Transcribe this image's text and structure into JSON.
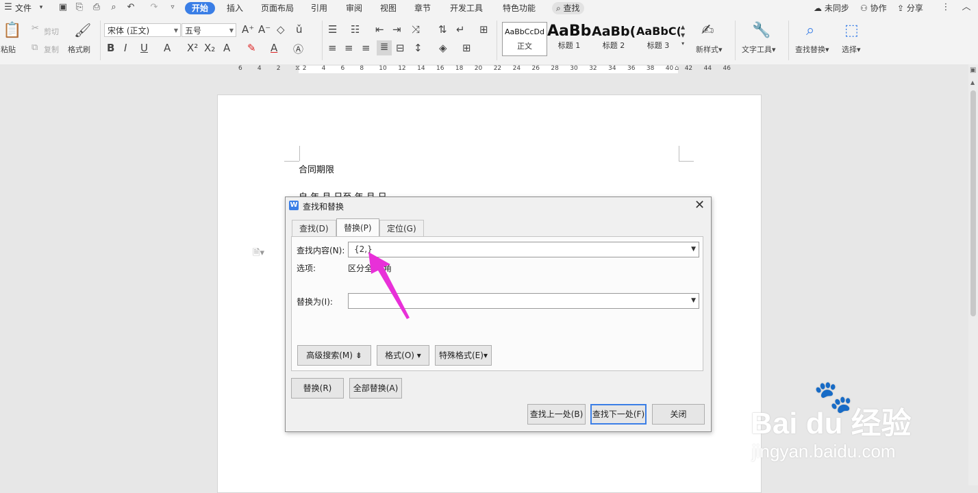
{
  "menubar": {
    "file": "文件",
    "tabs": [
      "开始",
      "插入",
      "页面布局",
      "引用",
      "审阅",
      "视图",
      "章节",
      "开发工具",
      "特色功能"
    ],
    "search": "查找",
    "right": {
      "sync": "未同步",
      "collab": "协作",
      "share": "分享"
    }
  },
  "ribbon": {
    "paste": "粘贴",
    "cut": "剪切",
    "copy": "复制",
    "format_painter": "格式刷",
    "font_name": "宋体 (正文)",
    "font_size": "五号",
    "styles": [
      {
        "sample": "AaBbCcDd",
        "name": "正文"
      },
      {
        "sample": "AaBb",
        "name": "标题 1"
      },
      {
        "sample": "AaBb(",
        "name": "标题 2"
      },
      {
        "sample": "AaBbC(",
        "name": "标题 3"
      }
    ],
    "new_style": "新样式",
    "text_tools": "文字工具",
    "find_replace": "查找替换",
    "select": "选择"
  },
  "ruler": {
    "ticks": [
      "6",
      "4",
      "2",
      "2",
      "4",
      "6",
      "8",
      "10",
      "12",
      "14",
      "16",
      "18",
      "20",
      "22",
      "24",
      "26",
      "28",
      "30",
      "32",
      "34",
      "36",
      "38",
      "40",
      "42",
      "44",
      "46"
    ]
  },
  "document": {
    "line1": "合同期限",
    "line2": "自      年      月      日至      年      月      日"
  },
  "dialog": {
    "title": "查找和替换",
    "tabs": [
      "查找(D)",
      "替换(P)",
      "定位(G)"
    ],
    "find_label": "查找内容(N):",
    "find_value": "{2,}",
    "options_label": "选项:",
    "options_value": "区分全/半角",
    "replace_label": "替换为(I):",
    "replace_value": "",
    "advanced_search": "高级搜索(M)",
    "format": "格式(O)",
    "special_format": "特殊格式(E)",
    "replace": "替换(R)",
    "replace_all": "全部替换(A)",
    "find_prev": "查找上一处(B)",
    "find_next": "查找下一处(F)",
    "close": "关闭"
  },
  "watermark": {
    "brand": "Bai du 经验",
    "url": "jingyan.baidu.com"
  },
  "colors": {
    "accent": "#3a7ee6",
    "arrow": "#e830d8"
  }
}
